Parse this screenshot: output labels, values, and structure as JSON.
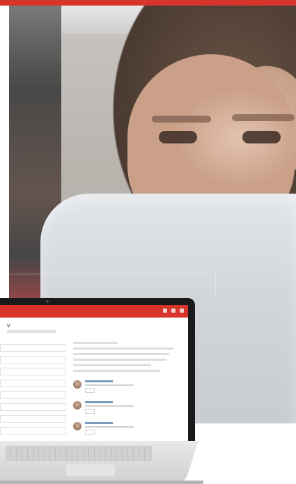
{
  "image": {
    "top_band_color": "#d9342b",
    "ui_accent_color": "#d9342b"
  },
  "laptop_screen": {
    "app_header_color": "#d9342b",
    "visible_text": {
      "title_fragment": "v"
    }
  }
}
